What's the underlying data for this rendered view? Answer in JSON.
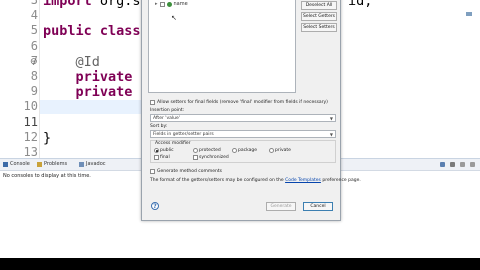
{
  "editor": {
    "lines": [
      {
        "num": "3",
        "marker": "",
        "tokens": [
          {
            "t": "import ",
            "c": "kw"
          },
          {
            "t": "org.spr",
            "c": ""
          }
        ]
      },
      {
        "num": "4",
        "marker": "",
        "tokens": []
      },
      {
        "num": "5",
        "marker": "",
        "tokens": [
          {
            "t": "public ",
            "c": "kw"
          },
          {
            "t": "class ",
            "c": "kw"
          },
          {
            "t": "Me",
            "c": ""
          }
        ]
      },
      {
        "num": "6",
        "marker": "",
        "tokens": []
      },
      {
        "num": "7",
        "marker": "⊖",
        "tokens": [
          {
            "t": "    @Id",
            "c": "ann"
          }
        ]
      },
      {
        "num": "8",
        "marker": "",
        "tokens": [
          {
            "t": "    private ",
            "c": "kw"
          },
          {
            "t": "St",
            "c": ""
          }
        ]
      },
      {
        "num": "9",
        "marker": "",
        "tokens": [
          {
            "t": "    private ",
            "c": "kw"
          },
          {
            "t": "in",
            "c": ""
          }
        ]
      },
      {
        "num": "10",
        "marker": "",
        "tokens": []
      },
      {
        "num": "11",
        "marker": "",
        "tokens": []
      },
      {
        "num": "12",
        "marker": "",
        "tokens": [
          {
            "t": "}",
            "c": ""
          }
        ]
      },
      {
        "num": "13",
        "marker": "",
        "tokens": []
      }
    ],
    "right_fragment": "id;"
  },
  "console": {
    "tabs": [
      {
        "label": "Console",
        "icon": "console-icon"
      },
      {
        "label": "Problems",
        "icon": "problems-icon"
      },
      {
        "label": "Javadoc",
        "icon": "javadoc-icon"
      }
    ],
    "message": "No consoles to display at this time."
  },
  "dialog": {
    "tree_item": "name",
    "buttons": {
      "deselect_all": "Deselect All",
      "select_getters": "Select Getters",
      "select_setters": "Select Setters"
    },
    "allow_setters_label": "Allow setters for final fields (remove 'final' modifier from fields if necessary)",
    "insertion_point_label": "Insertion point:",
    "insertion_point_value": "After 'value'",
    "sort_by_label": "Sort by:",
    "sort_by_value": "Fields in getter/setter pairs",
    "access_modifier_label": "Access modifier",
    "access_modifiers": [
      {
        "label": "public",
        "selected": true
      },
      {
        "label": "protected",
        "selected": false
      },
      {
        "label": "package",
        "selected": false
      },
      {
        "label": "private",
        "selected": false
      }
    ],
    "final_label": "final",
    "synchronized_label": "synchronized",
    "generate_comments_label": "Generate method comments",
    "format_text_before": "The format of the getters/setters may be configured on the ",
    "format_link": "Code Templates",
    "format_text_after": " preference page.",
    "generate_button": "Generate",
    "cancel_button": "Cancel",
    "help_glyph": "?"
  },
  "colors": {
    "keyword": "#7f0055",
    "annotation": "#646464",
    "current_line": "#e8f2fe",
    "link": "#0645ad"
  }
}
